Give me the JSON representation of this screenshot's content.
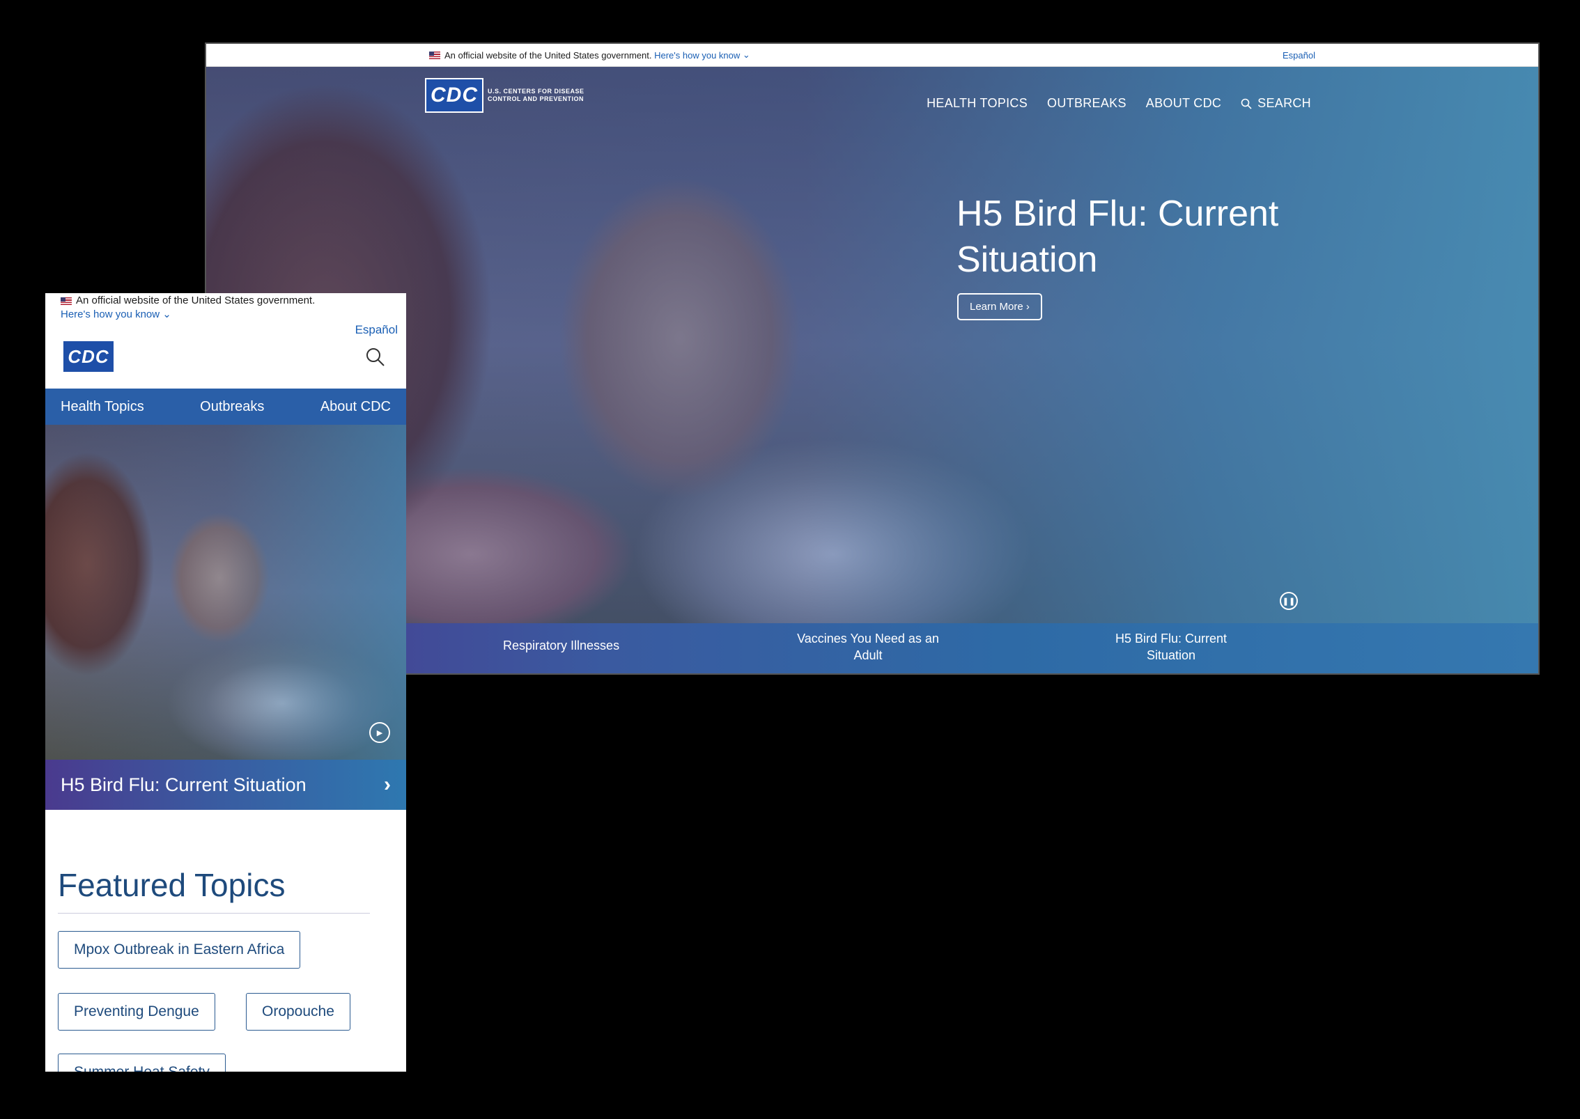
{
  "desktop": {
    "gov_banner": {
      "text": "An official website of the United States government.",
      "link": "Here's how you know",
      "espanol": "Español"
    },
    "logo": {
      "abbr": "CDC",
      "line1": "U.S. CENTERS FOR DISEASE",
      "line2": "CONTROL AND PREVENTION"
    },
    "nav": [
      "HEALTH TOPICS",
      "OUTBREAKS",
      "ABOUT CDC",
      "SEARCH"
    ],
    "hero": {
      "title": "H5 Bird Flu: Current Situation",
      "button": "Learn More"
    },
    "carousel": [
      "Respiratory Illnesses",
      "Vaccines You Need as an Adult",
      "H5 Bird Flu: Current Situation"
    ]
  },
  "mobile": {
    "gov_banner": {
      "text": "An official website of the United States government.",
      "link": "Here's how you know",
      "espanol": "Español"
    },
    "logo": {
      "abbr": "CDC"
    },
    "nav": [
      "Health Topics",
      "Outbreaks",
      "About CDC"
    ],
    "hero_caption": "H5 Bird Flu: Current Situation",
    "featured": {
      "title": "Featured Topics",
      "chips": [
        "Mpox Outbreak in Eastern Africa",
        "Preventing Dengue",
        "Oropouche",
        "Summer Heat Safety"
      ]
    }
  }
}
